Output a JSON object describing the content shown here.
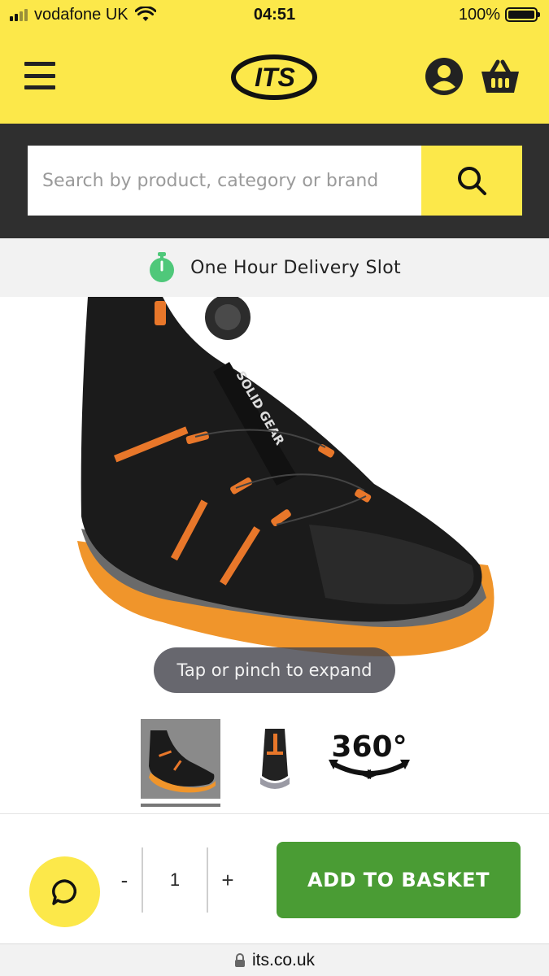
{
  "status_bar": {
    "carrier": "vodafone UK",
    "time": "04:51",
    "battery": "100%"
  },
  "header": {
    "logo_text": "ITS",
    "menu_icon": "hamburger-menu-icon",
    "account_icon": "account-icon",
    "basket_icon": "basket-icon",
    "brand_color": "#fce84a"
  },
  "search": {
    "placeholder": "Search by product, category or brand",
    "value": "",
    "icon": "search-icon"
  },
  "delivery": {
    "label": "One Hour Delivery Slot",
    "icon": "stopwatch-icon",
    "icon_color": "#4fc87a"
  },
  "product": {
    "expand_hint": "Tap or pinch to expand",
    "thumbnails": [
      {
        "icon": "boot-side-thumbnail",
        "selected": true
      },
      {
        "icon": "boot-back-thumbnail",
        "selected": false
      },
      {
        "icon": "360-view-icon",
        "label": "360°",
        "selected": false
      }
    ]
  },
  "purchase": {
    "minus_label": "-",
    "plus_label": "+",
    "quantity": "1",
    "add_to_basket_label": "ADD TO BASKET",
    "add_color": "#4a9c34",
    "chat_icon": "chat-bubble-icon"
  },
  "url_bar": {
    "url": "its.co.uk",
    "lock_icon": "lock-icon"
  }
}
